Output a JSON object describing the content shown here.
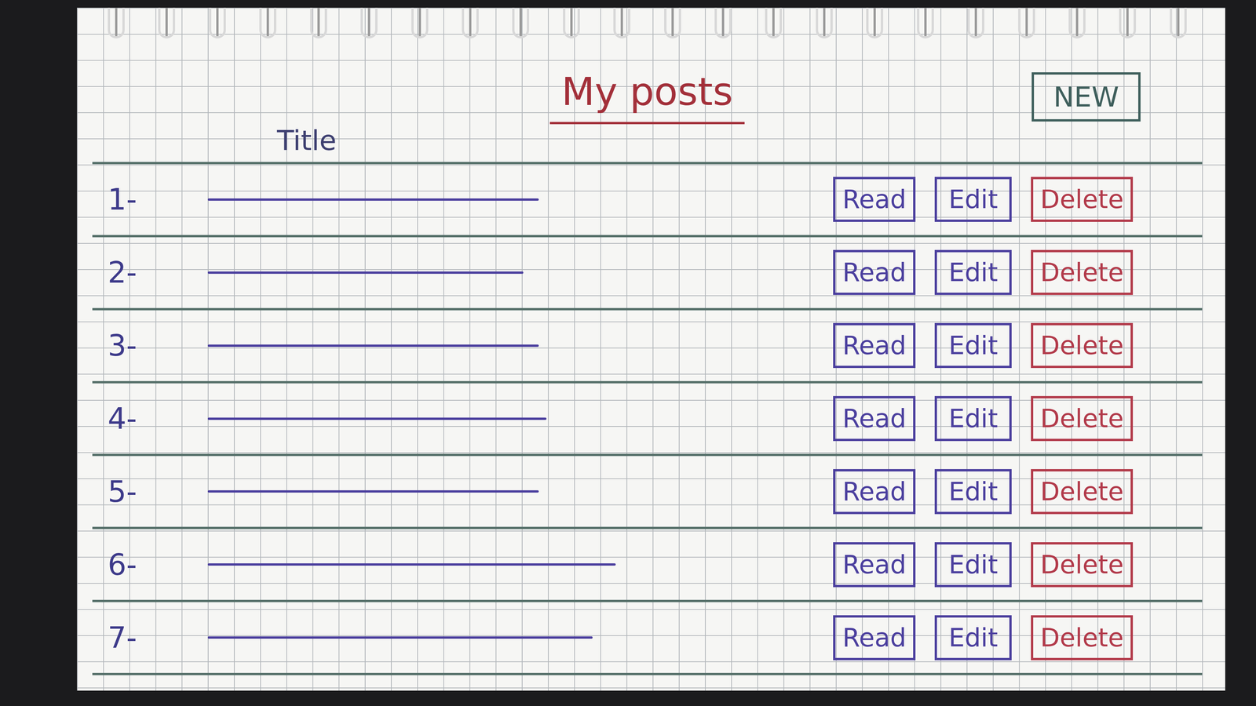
{
  "page": {
    "title": "My posts",
    "new_button": "NEW"
  },
  "table": {
    "columns": [
      "Title"
    ],
    "rows": [
      {
        "index": "1-",
        "actions": [
          {
            "label": "Read",
            "color": "#4b3f9e"
          },
          {
            "label": "Edit",
            "color": "#4b3f9e"
          },
          {
            "label": "Delete",
            "color": "#b23a4a"
          }
        ]
      },
      {
        "index": "2-",
        "actions": [
          {
            "label": "Read",
            "color": "#4b3f9e"
          },
          {
            "label": "Edit",
            "color": "#4b3f9e"
          },
          {
            "label": "Delete",
            "color": "#b23a4a"
          }
        ]
      },
      {
        "index": "3-",
        "actions": [
          {
            "label": "Read",
            "color": "#4b3f9e"
          },
          {
            "label": "Edit",
            "color": "#4b3f9e"
          },
          {
            "label": "Delete",
            "color": "#b23a4a"
          }
        ]
      },
      {
        "index": "4-",
        "actions": [
          {
            "label": "Read",
            "color": "#4b3f9e"
          },
          {
            "label": "Edit",
            "color": "#4b3f9e"
          },
          {
            "label": "Delete",
            "color": "#b23a4a"
          }
        ]
      },
      {
        "index": "5-",
        "actions": [
          {
            "label": "Read",
            "color": "#4b3f9e"
          },
          {
            "label": "Edit",
            "color": "#4b3f9e"
          },
          {
            "label": "Delete",
            "color": "#b23a4a"
          }
        ]
      },
      {
        "index": "6-",
        "actions": [
          {
            "label": "Read",
            "color": "#4b3f9e"
          },
          {
            "label": "Edit",
            "color": "#4b3f9e"
          },
          {
            "label": "Delete",
            "color": "#b23a4a"
          }
        ]
      },
      {
        "index": "7-",
        "actions": [
          {
            "label": "Read",
            "color": "#4b3f9e"
          },
          {
            "label": "Edit",
            "color": "#4b3f9e"
          },
          {
            "label": "Delete",
            "color": "#b23a4a"
          }
        ]
      }
    ]
  }
}
